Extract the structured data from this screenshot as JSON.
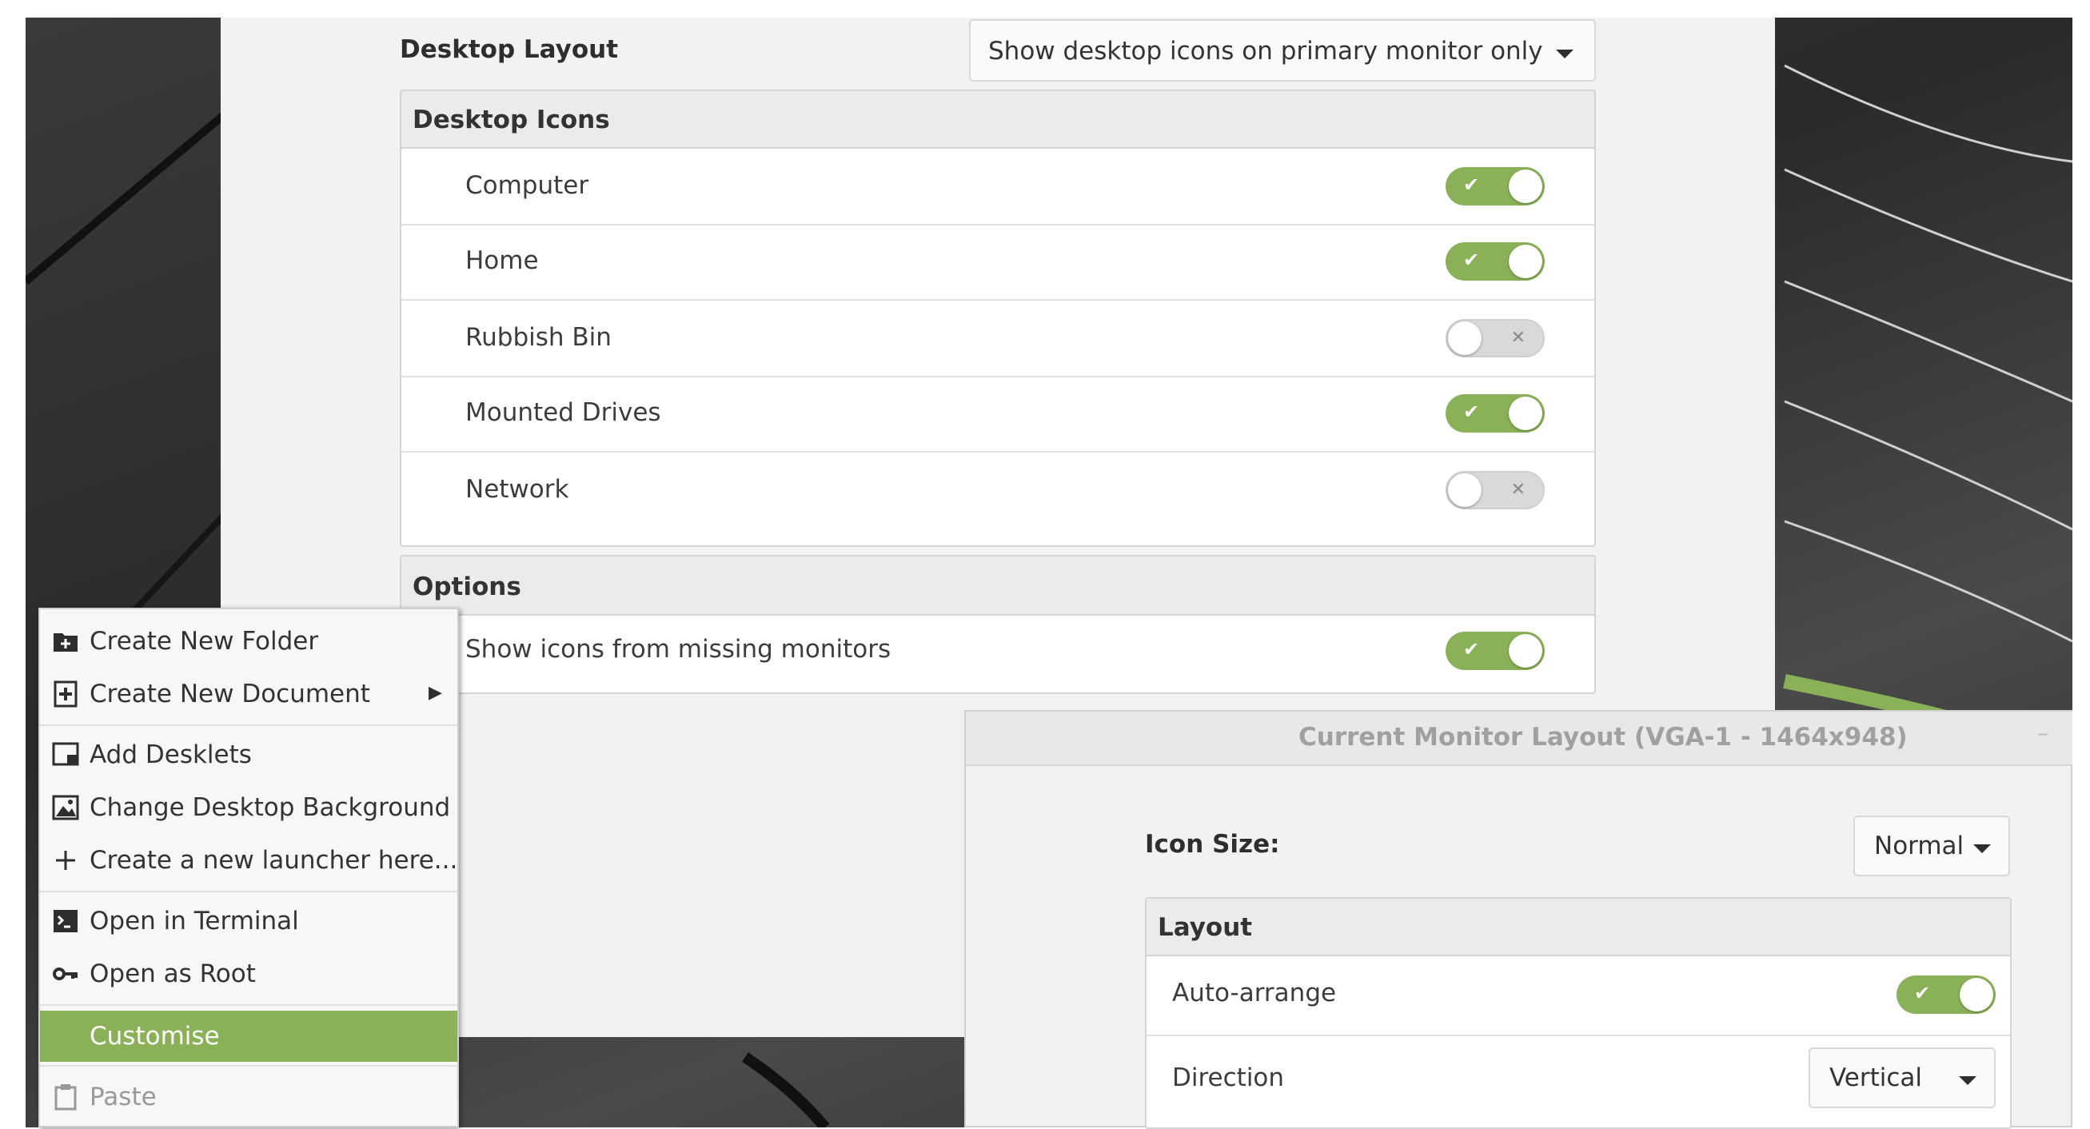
{
  "settings": {
    "desktop_layout_label": "Desktop Layout",
    "desktop_layout_value": "Show desktop icons on primary monitor only",
    "desktop_icons_header": "Desktop Icons",
    "icons": [
      {
        "label": "Computer",
        "enabled": true
      },
      {
        "label": "Home",
        "enabled": true
      },
      {
        "label": "Rubbish Bin",
        "enabled": false
      },
      {
        "label": "Mounted Drives",
        "enabled": true
      },
      {
        "label": "Network",
        "enabled": false
      }
    ],
    "options_header": "Options",
    "options": [
      {
        "label": "Show icons from missing monitors",
        "enabled": true
      }
    ]
  },
  "context_menu": {
    "items": [
      {
        "label": "Create New Folder",
        "icon": "new-folder-icon"
      },
      {
        "label": "Create New Document",
        "icon": "new-document-icon",
        "submenu": true
      },
      {
        "label": "Add Desklets",
        "icon": "desklets-icon"
      },
      {
        "label": "Change Desktop Background",
        "icon": "image-icon"
      },
      {
        "label": "Create a new launcher here...",
        "icon": "plus-icon"
      },
      {
        "label": "Open in Terminal",
        "icon": "terminal-icon"
      },
      {
        "label": "Open as Root",
        "icon": "key-icon"
      },
      {
        "label": "Customise",
        "highlighted": true
      },
      {
        "label": "Paste",
        "icon": "clipboard-icon",
        "disabled": true
      }
    ]
  },
  "monitor_window": {
    "title": "Current Monitor Layout (VGA-1 - 1464x948)",
    "minimize_symbol": "–",
    "icon_size_label": "Icon Size:",
    "icon_size_value": "Normal",
    "layout_header": "Layout",
    "auto_arrange_label": "Auto-arrange",
    "auto_arrange_enabled": true,
    "direction_label": "Direction",
    "direction_value": "Vertical"
  },
  "switch_symbols": {
    "on": "✔",
    "off": "✕"
  },
  "submenu_arrow": "▶",
  "colors": {
    "accent": "#8bb158",
    "window_bg": "#f2f2f2",
    "desktop_bg": "#2f2f2f"
  }
}
